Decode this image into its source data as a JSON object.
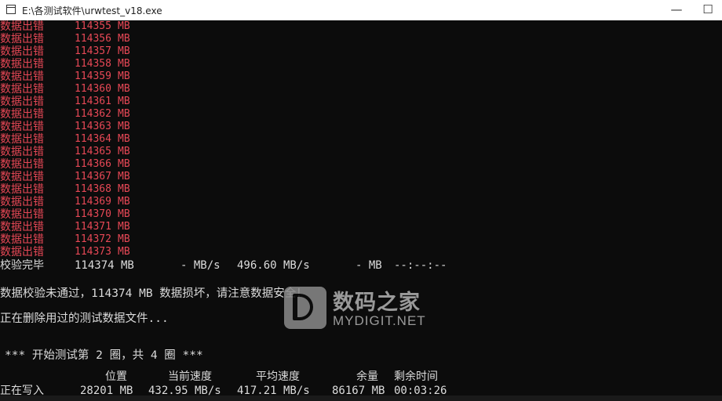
{
  "window": {
    "title": "E:\\各测试软件\\urwtest_v18.exe",
    "minimize": "—",
    "maximize": "☐"
  },
  "errors": {
    "label": "数据出错",
    "unit": "MB",
    "values": [
      "114355",
      "114356",
      "114357",
      "114358",
      "114359",
      "114360",
      "114361",
      "114362",
      "114363",
      "114364",
      "114365",
      "114366",
      "114367",
      "114368",
      "114369",
      "114370",
      "114371",
      "114372",
      "114373"
    ]
  },
  "verify_row": {
    "status": "校验完毕",
    "position": "114374 MB",
    "current_speed": "- MB/s",
    "average_speed": "496.60 MB/s",
    "remaining": "- MB",
    "time_left": "--:--:--"
  },
  "messages": {
    "verify_failed": "数据校验未通过，114374 MB 数据损坏，请注意数据安全！",
    "deleting": "正在删除用过的测试数据文件...",
    "round_start": "*** 开始测试第 2 圈，共 4 圈 ***"
  },
  "progress_header": {
    "position": "位置",
    "current_speed": "当前速度",
    "average_speed": "平均速度",
    "remaining": "余量",
    "time_left": "剩余时间"
  },
  "progress_row": {
    "status": "正在写入",
    "position": "28201 MB",
    "current_speed": "432.95 MB/s",
    "average_speed": "417.21 MB/s",
    "remaining": "86167 MB",
    "time_left": "00:03:26"
  },
  "watermark": {
    "name_cn": "数码之家",
    "name_en": "MYDIGIT.NET"
  },
  "colors": {
    "error_text": "#e74856",
    "normal_text": "#dcdcdc",
    "background": "#0c0c0c"
  }
}
